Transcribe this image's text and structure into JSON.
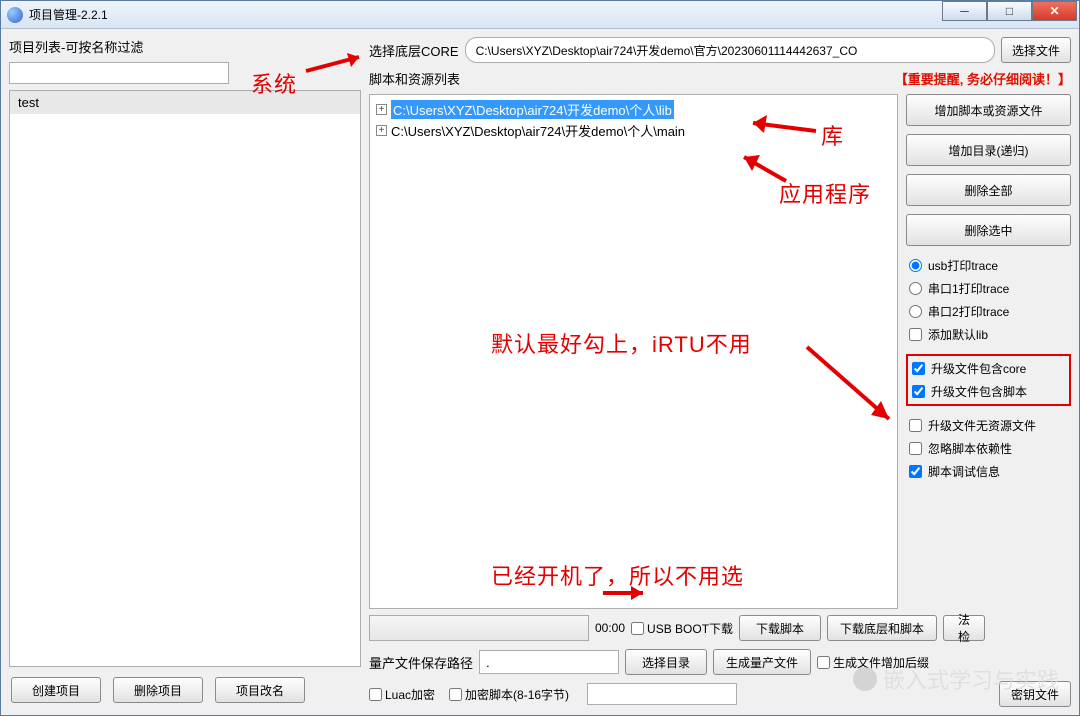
{
  "window": {
    "title": "项目管理-2.2.1"
  },
  "left": {
    "filter_label": "项目列表-可按名称过滤",
    "filter_value": "",
    "projects": [
      "test"
    ],
    "btn_create": "创建项目",
    "btn_delete": "删除项目",
    "btn_rename": "项目改名"
  },
  "core": {
    "label": "选择底层CORE",
    "path": "C:\\Users\\XYZ\\Desktop\\air724\\开发demo\\官方\\20230601114442637_CO",
    "btn_select": "选择文件"
  },
  "list": {
    "label": "脚本和资源列表",
    "notice": "【重要提醒, 务必仔细阅读！】",
    "items": [
      {
        "path": "C:\\Users\\XYZ\\Desktop\\air724\\开发demo\\个人\\lib",
        "selected": true
      },
      {
        "path": "C:\\Users\\XYZ\\Desktop\\air724\\开发demo\\个人\\main",
        "selected": false
      }
    ]
  },
  "side": {
    "btn_add_file": "增加脚本或资源文件",
    "btn_add_dir": "增加目录(递归)",
    "btn_del_all": "删除全部",
    "btn_del_sel": "删除选中",
    "radio_usb": "usb打印trace",
    "radio_com1": "串口1打印trace",
    "radio_com2": "串口2打印trace",
    "chk_addlib": "添加默认lib",
    "chk_core": "升级文件包含core",
    "chk_script": "升级文件包含脚本",
    "chk_nores": "升级文件无资源文件",
    "chk_ignore": "忽略脚本依赖性",
    "chk_debug": "脚本调试信息"
  },
  "download": {
    "time": "00:00",
    "chk_usb_boot": "USB BOOT下载",
    "btn_dl_script": "下载脚本",
    "btn_dl_both": "下载底层和脚本",
    "btn_check": "法检"
  },
  "mass": {
    "label": "量产文件保存路径",
    "path": ".",
    "btn_select_dir": "选择目录",
    "btn_gen": "生成量产文件",
    "chk_suffix": "生成文件增加后缀"
  },
  "encrypt": {
    "chk_luac": "Luac加密",
    "chk_enc": "加密脚本(8-16字节)",
    "enc_value": "",
    "btn_keyfile": "密钥文件"
  },
  "annotations": {
    "sys": "系统",
    "lib": "库",
    "app": "应用程序",
    "tip1": "默认最好勾上，iRTU不用",
    "tip2": "已经开机了，所以不用选"
  },
  "watermark": "嵌入式学习与实践",
  "wincontrols": {
    "min": "─",
    "max": "□",
    "close": "✕"
  }
}
